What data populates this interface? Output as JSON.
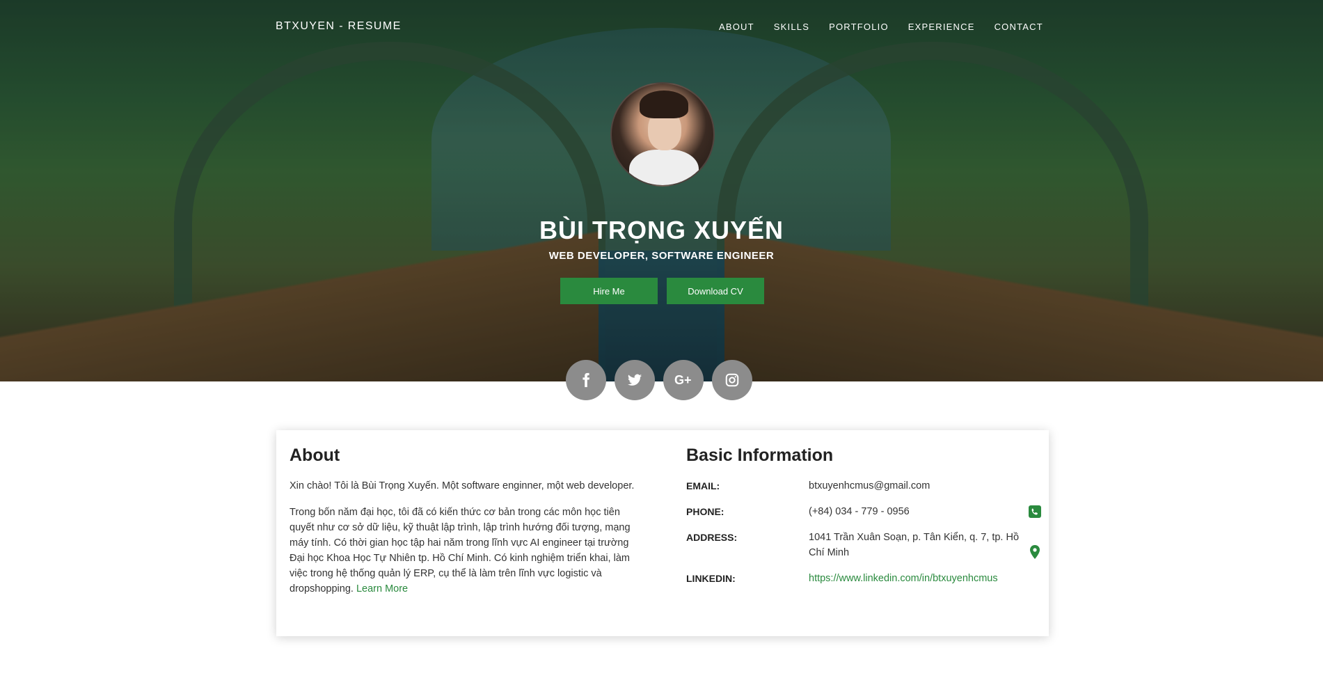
{
  "header": {
    "brand": "BTXUYEN - RESUME",
    "nav": [
      "ABOUT",
      "SKILLS",
      "PORTFOLIO",
      "EXPERIENCE",
      "CONTACT"
    ]
  },
  "hero": {
    "name": "BÙI TRỌNG XUYẾN",
    "title": "WEB DEVELOPER, SOFTWARE ENGINEER",
    "hire_label": "Hire Me",
    "cv_label": "Download CV"
  },
  "socials": [
    {
      "icon": "facebook-icon",
      "glyph": "f"
    },
    {
      "icon": "twitter-icon",
      "glyph": "🐦"
    },
    {
      "icon": "google-plus-icon",
      "glyph": "G+"
    },
    {
      "icon": "instagram-icon",
      "glyph": "◎"
    }
  ],
  "about": {
    "heading": "About",
    "p1": "Xin chào! Tôi là Bùi Trọng Xuyến. Một software enginner, một web developer.",
    "p2": "Trong bốn năm đại học, tôi đã có kiến thức cơ bản trong các môn học tiên quyết như cơ sở dữ liệu, kỹ thuật lập trình, lập trình hướng đối tượng, mạng máy tính. Có thời gian học tập hai năm trong lĩnh vực AI engineer tại trường Đại học Khoa Học Tự Nhiên tp. Hồ Chí Minh. Có kinh nghiệm triển khai, làm việc trong hệ thống quản lý ERP, cụ thể là làm trên lĩnh vực logistic và dropshopping.",
    "learn_more": "Learn More"
  },
  "basic": {
    "heading": "Basic Information",
    "email_label": "EMAIL:",
    "email": "btxuyenhcmus@gmail.com",
    "phone_label": "PHONE:",
    "phone": "(+84) 034 - 779 - 0956",
    "address_label": "ADDRESS:",
    "address": "1041 Trần Xuân Soạn, p. Tân Kiển, q. 7, tp. Hồ Chí Minh",
    "linkedin_label": "LINKEDIN:",
    "linkedin": "https://www.linkedin.com/in/btxuyenhcmus"
  },
  "colors": {
    "accent": "#2a8a3e",
    "social_bg": "#8c8c8c"
  }
}
